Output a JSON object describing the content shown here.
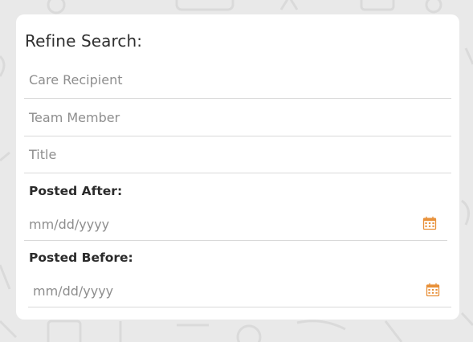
{
  "refine": {
    "title": "Refine Search:",
    "fields": {
      "care_recipient": {
        "placeholder": "Care Recipient",
        "value": ""
      },
      "team_member": {
        "placeholder": "Team Member",
        "value": ""
      },
      "title": {
        "placeholder": "Title",
        "value": ""
      }
    },
    "posted_after": {
      "label": "Posted After:",
      "placeholder": "mm/dd/yyyy",
      "value": ""
    },
    "posted_before": {
      "label": "Posted Before:",
      "placeholder": "mm/dd/yyyy",
      "value": ""
    }
  },
  "icons": {
    "calendar": "calendar-icon"
  },
  "colors": {
    "accent": "#e8913a",
    "background": "#e9e9e9",
    "card": "#ffffff"
  }
}
